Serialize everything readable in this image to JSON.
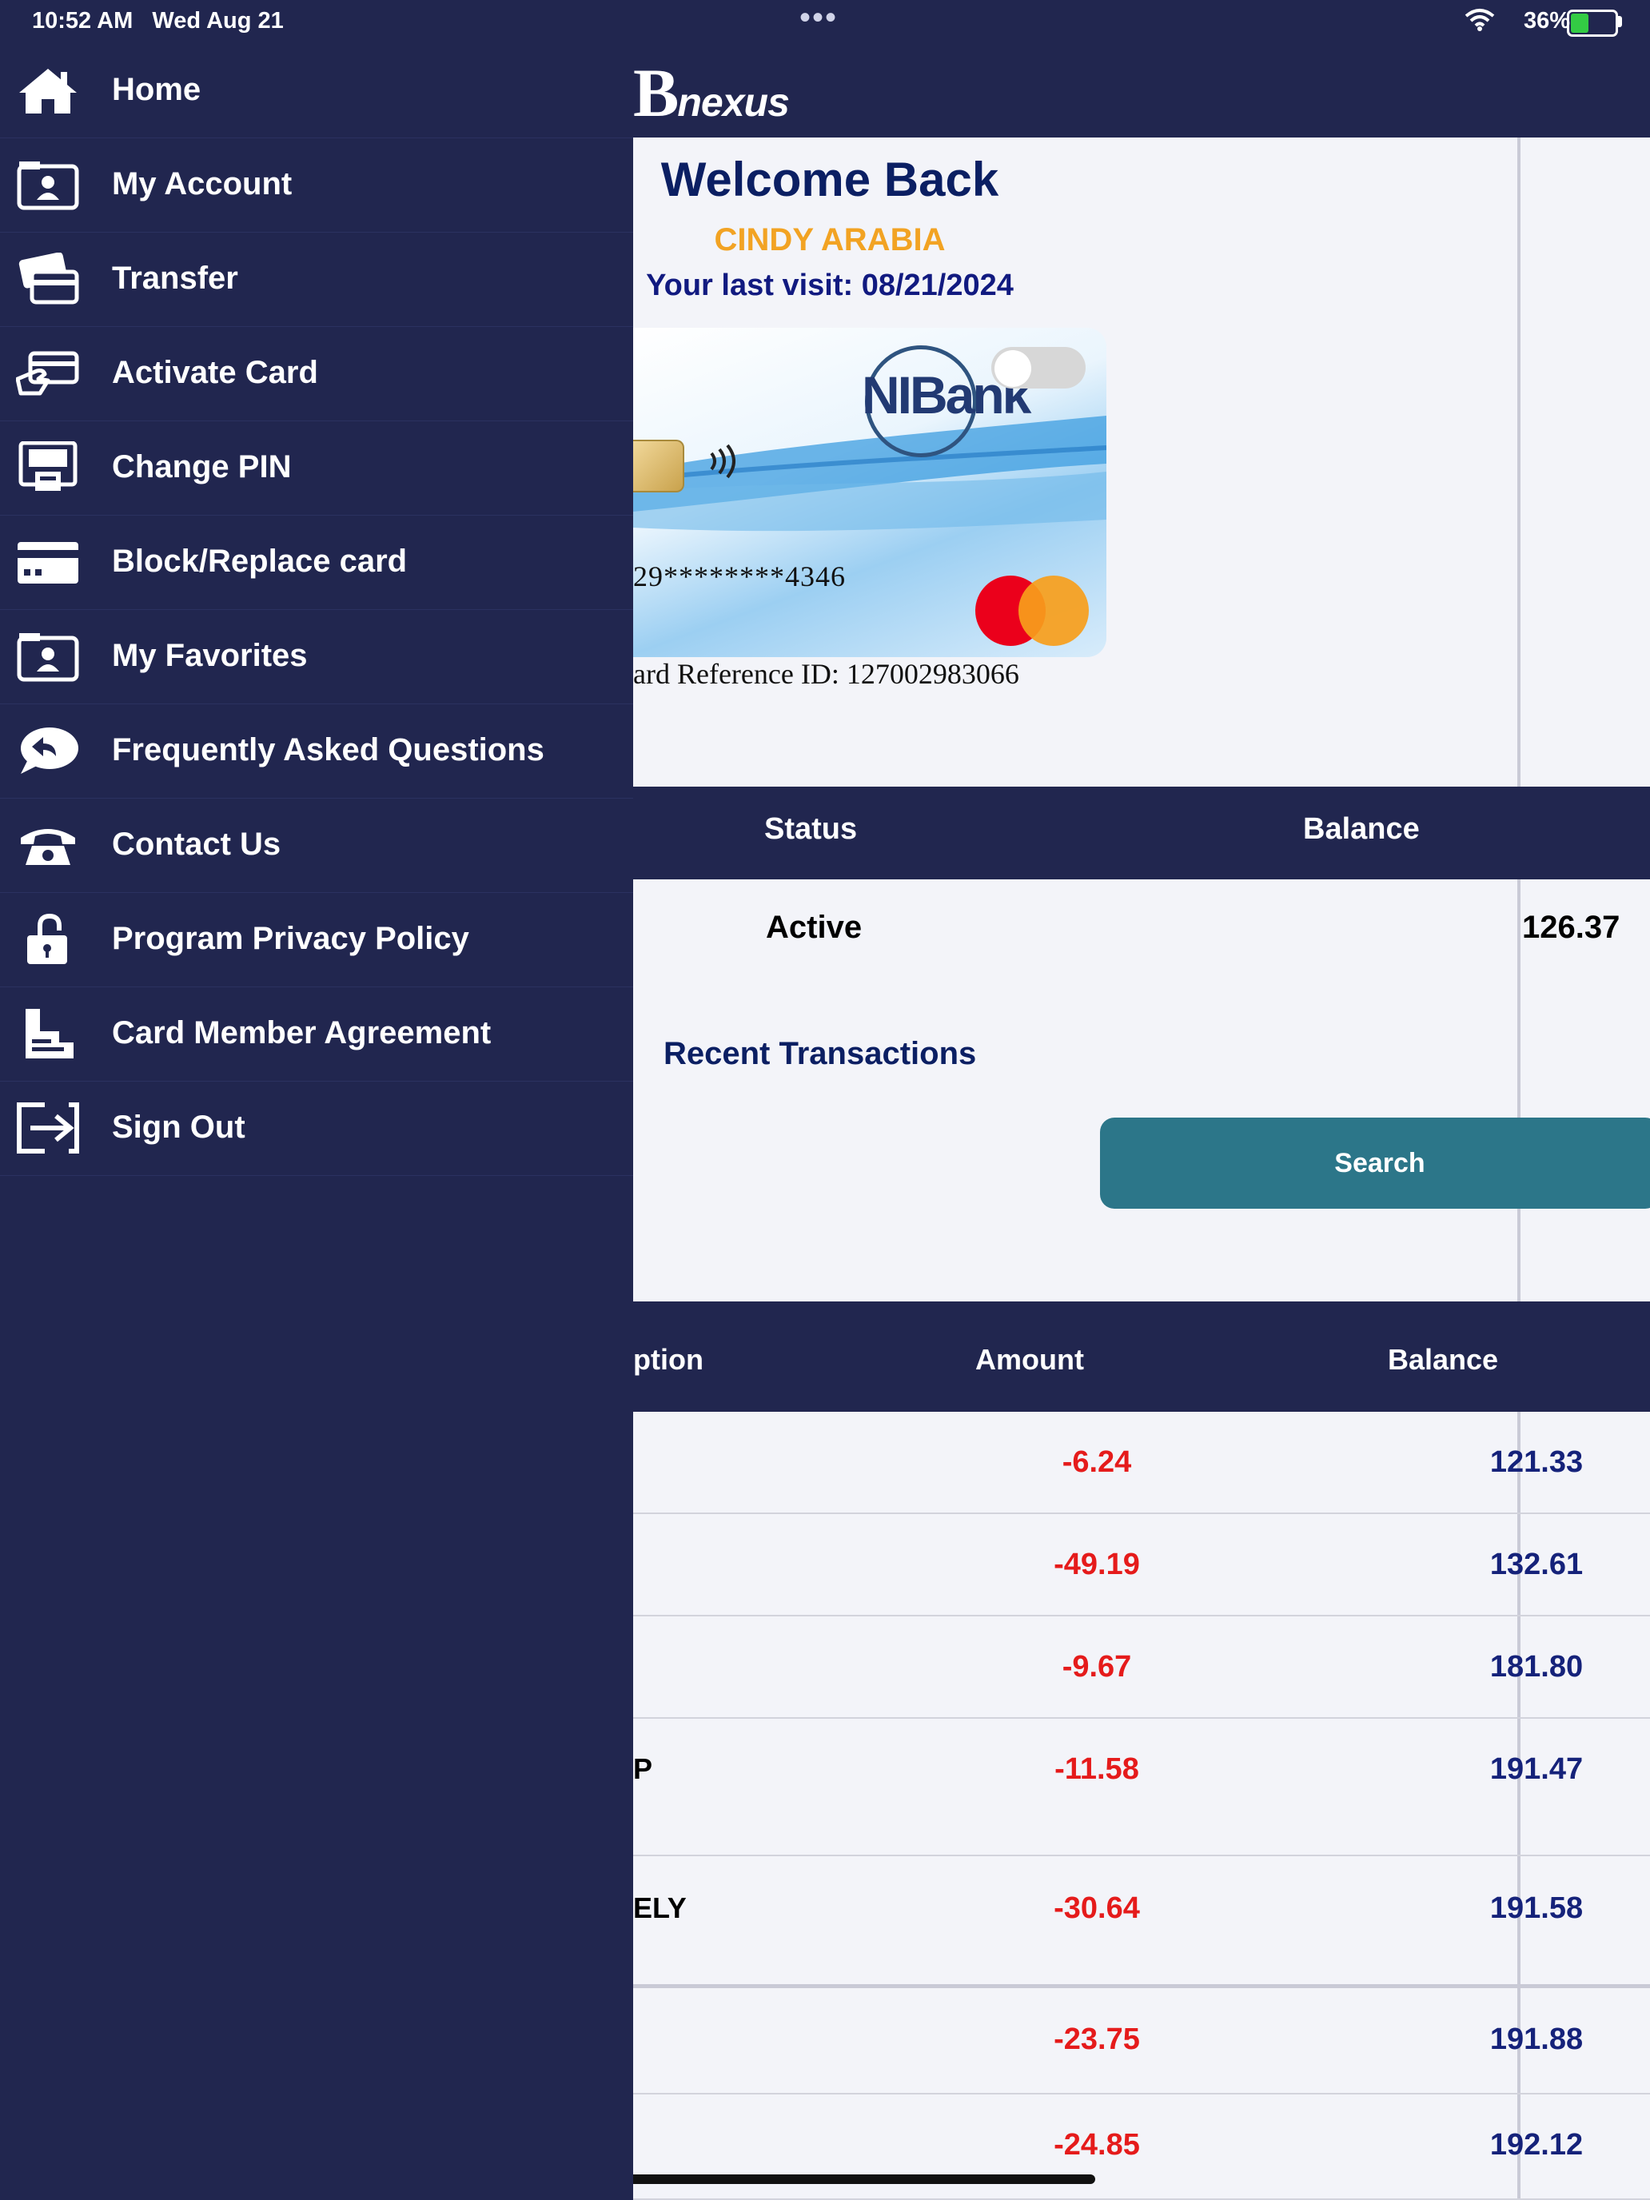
{
  "status_bar": {
    "time": "10:52 AM   Wed Aug 21",
    "dots": "•••",
    "battery": "36%"
  },
  "brand": {
    "logo_initial": "B",
    "logo_rest": "nexus"
  },
  "welcome": {
    "title": "Welcome Back",
    "user_name": "CINDY ARABIA",
    "last_visit": "Your last visit: 08/21/2024"
  },
  "card": {
    "bank_logo": "NIBank",
    "number": "29********4346",
    "reference": "ard Reference ID: 127002983066",
    "network": "mastercard"
  },
  "account": {
    "status_header": "Status",
    "balance_header": "Balance",
    "status": "Active",
    "balance": "126.37"
  },
  "transactions": {
    "title": "Recent Transactions",
    "search_label": "Search",
    "headers": {
      "description": "ption",
      "amount": "Amount",
      "balance": "Balance"
    },
    "rows": [
      {
        "description": "",
        "amount": "-6.24",
        "balance": "121.33"
      },
      {
        "description": "",
        "amount": "-49.19",
        "balance": "132.61"
      },
      {
        "description": "",
        "amount": "-9.67",
        "balance": "181.80"
      },
      {
        "description": "P",
        "amount": "-11.58",
        "balance": "191.47"
      },
      {
        "description": "ELY",
        "amount": "-30.64",
        "balance": "191.58"
      },
      {
        "description": "",
        "amount": "-23.75",
        "balance": "191.88"
      },
      {
        "description": "",
        "amount": "-24.85",
        "balance": "192.12"
      }
    ]
  },
  "menu": {
    "items": [
      {
        "label": "Home",
        "icon": "home-icon"
      },
      {
        "label": "My Account",
        "icon": "id-card-icon"
      },
      {
        "label": "Transfer",
        "icon": "transfer-cards-icon"
      },
      {
        "label": "Activate Card",
        "icon": "card-hand-icon"
      },
      {
        "label": "Change PIN",
        "icon": "atm-icon"
      },
      {
        "label": "Block/Replace card",
        "icon": "credit-card-icon"
      },
      {
        "label": "My Favorites",
        "icon": "favorites-folder-icon"
      },
      {
        "label": "Frequently Asked Questions",
        "icon": "chat-reply-icon"
      },
      {
        "label": "Contact Us",
        "icon": "telephone-icon"
      },
      {
        "label": "Program Privacy Policy",
        "icon": "lock-icon"
      },
      {
        "label": "Card Member Agreement",
        "icon": "agreement-document-icon"
      },
      {
        "label": "Sign Out",
        "icon": "sign-out-icon"
      }
    ]
  },
  "colors": {
    "navy": "#21264f",
    "accent_orange": "#f2a323",
    "negative_red": "#e51b1b",
    "button_teal": "#2c7689"
  }
}
